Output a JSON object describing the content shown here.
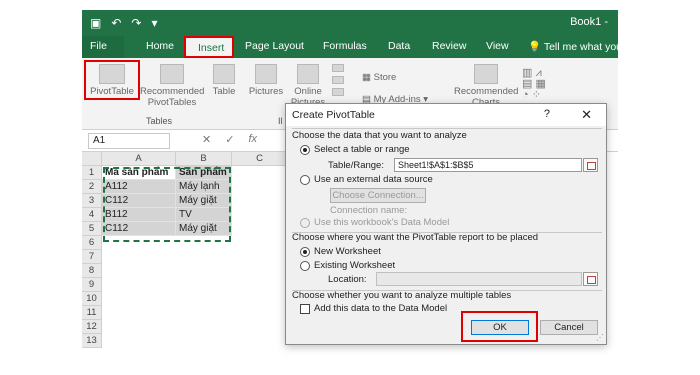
{
  "app": {
    "title": "Book1 -",
    "tell_me": "Tell me what you"
  },
  "ribbon_tabs": [
    "File",
    "Home",
    "Insert",
    "Page Layout",
    "Formulas",
    "Data",
    "Review",
    "View"
  ],
  "ribbon": {
    "pivottable": "PivotTable",
    "recommended_pivot_line1": "Recommended",
    "recommended_pivot_line2": "PivotTables",
    "table": "Table",
    "group_tables": "Tables",
    "pictures": "Pictures",
    "online_line1": "Online",
    "online_line2": "Pictures",
    "store": "Store",
    "my_addins": "My Add-ins",
    "recommended_charts_line1": "Recommended",
    "recommended_charts_line2": "Charts",
    "group_illus_short": "Il"
  },
  "formula_bar": {
    "name_box": "A1",
    "fx": "fx"
  },
  "sheet": {
    "columns": [
      "A",
      "B",
      "C"
    ],
    "rows": [
      "1",
      "2",
      "3",
      "4",
      "5",
      "6",
      "7",
      "8",
      "9",
      "10",
      "11",
      "12",
      "13"
    ],
    "data": [
      [
        "Mã sản phẩm",
        "Sản phẩm"
      ],
      [
        "A112",
        "Máy lạnh"
      ],
      [
        "C112",
        "Máy giặt"
      ],
      [
        "B112",
        "TV"
      ],
      [
        "C112",
        "Máy giặt"
      ]
    ]
  },
  "dialog": {
    "title": "Create PivotTable",
    "help": "?",
    "close": "✕",
    "section1": "Choose the data that you want to analyze",
    "opt_select_table": "Select a table or range",
    "table_range_label": "Table/Range:",
    "table_range_value": "Sheet1!$A$1:$B$5",
    "opt_external": "Use an external data source",
    "choose_connection": "Choose Connection...",
    "connection_name": "Connection name:",
    "opt_data_model": "Use this workbook's Data Model",
    "section2": "Choose where you want the PivotTable report to be placed",
    "opt_new_ws": "New Worksheet",
    "opt_existing_ws": "Existing Worksheet",
    "location_label": "Location:",
    "section3": "Choose whether you want to analyze multiple tables",
    "add_to_model": "Add this data to the Data Model",
    "ok": "OK",
    "cancel": "Cancel"
  }
}
